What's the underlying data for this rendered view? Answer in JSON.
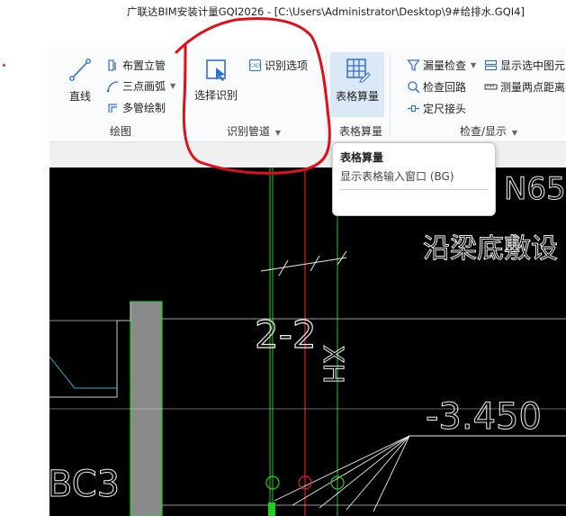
{
  "window": {
    "title": "广联达BIM安装计量GQI2026 - [C:\\Users\\Administrator\\Desktop\\9#给排水.GQI4]"
  },
  "ribbon": {
    "draw_group": {
      "label": "绘图",
      "line": "直线",
      "place_riser": "布置立管",
      "three_point_arc": "三点画弧",
      "multi_pipe_draw": "多管绘制"
    },
    "recognize_group": {
      "label": "识别管道",
      "select_recognize": "选择识别",
      "recognize_options": "识别选项"
    },
    "table_group": {
      "label": "表格算量",
      "table_calc": "表格算量"
    },
    "check_group": {
      "label": "检查/显示",
      "missing_check": "漏量检查",
      "show_selected": "显示选中图元",
      "check_loop": "检查回路",
      "measure_distance": "测量两点距离",
      "fixed_length_joint": "定尺接头"
    }
  },
  "tooltip": {
    "title": "表格算量",
    "description": "显示表格输入窗口 (BG)"
  },
  "cad": {
    "label_n65": "N65",
    "label_beam": "沿梁底敷设",
    "label_elev": "-3.450",
    "label_bc3": "BC3",
    "label_2z": "2-2",
    "label_xh": "XH"
  },
  "colors": {
    "cad_background": "#000000",
    "green_line": "#22cc22",
    "red_line": "#e02020",
    "annotation": "#e0101a",
    "highlight_button": "#dbe8f6"
  }
}
